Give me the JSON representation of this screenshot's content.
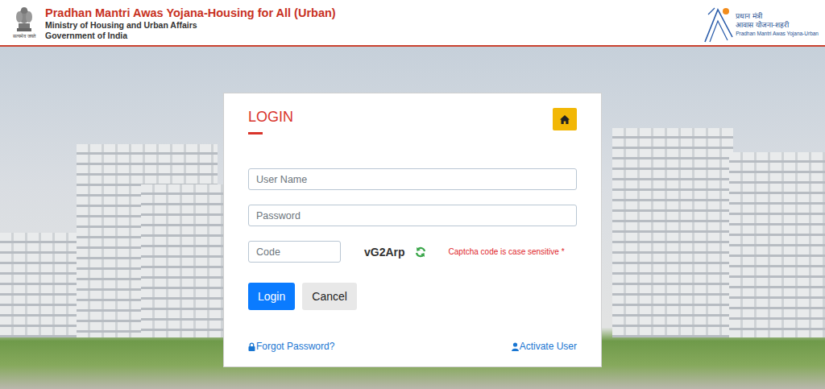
{
  "header": {
    "title": "Pradhan Mantri Awas Yojana-Housing for All (Urban)",
    "ministry": "Ministry of Housing and Urban Affairs",
    "government": "Government of India",
    "emblem_motto": "सत्यमेव जयते",
    "logo_lines": [
      "प्रधान मंत्री",
      "आवास योजना-शहरी",
      "Pradhan Mantri Awas Yojana-Urban"
    ]
  },
  "login": {
    "title": "LOGIN",
    "fields": [
      {
        "placeholder": "User Name"
      },
      {
        "placeholder": "Password"
      }
    ],
    "captcha": {
      "placeholder": "Code",
      "code": "vG2Arp",
      "note": "Captcha code is case sensitive *"
    },
    "buttons": [
      "Login",
      "Cancel"
    ],
    "links": [
      "Forgot Password?",
      "Activate User"
    ]
  }
}
